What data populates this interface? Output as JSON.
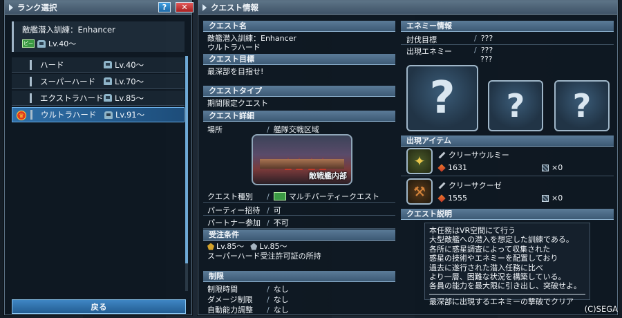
{
  "rank_panel": {
    "title": "ランク選択",
    "help_label": "?",
    "close_label": "✕",
    "quest_name": "敵艦潜入訓練：Enhancer",
    "quest_badge": "ピー",
    "quest_level": "Lv.40～",
    "ranks": [
      {
        "label": "ハード",
        "level": "Lv.40～"
      },
      {
        "label": "スーパーハード",
        "level": "Lv.70～"
      },
      {
        "label": "エクストラハード",
        "level": "Lv.85～"
      },
      {
        "label": "ウルトラハード",
        "level": "Lv.91～"
      }
    ],
    "back_label": "戻る"
  },
  "info_panel": {
    "title": "クエスト情報",
    "quest_name_header": "クエスト名",
    "quest_name_line1": "敵艦潜入訓練：Enhancer",
    "quest_name_line2": "ウルトラハード",
    "objective_header": "クエスト目標",
    "objective": "最深部を目指せ!",
    "type_header": "クエストタイプ",
    "type": "期間限定クエスト",
    "detail_header": "クエスト詳細",
    "location_label": "場所",
    "location_value": "艦隊交戦区域",
    "location_caption": "敵戦艦内部",
    "category_label": "クエスト種別",
    "category_value": "マルチパーティークエスト",
    "party_label": "パーティー招待",
    "party_value": "可",
    "partner_label": "パートナー参加",
    "partner_value": "不可",
    "conditions_header": "受注条件",
    "cond_lv1": "Lv.85～",
    "cond_lv2": "Lv.85～",
    "cond_text": "スーパーハード受注許可証の所持",
    "limits_header": "制限",
    "time_label": "制限時間",
    "time_value": "なし",
    "damage_label": "ダメージ制限",
    "damage_value": "なし",
    "auto_label": "自動能力調整",
    "auto_value": "なし",
    "enemy_header": "エネミー情報",
    "target_label": "討伐目標",
    "target_value": "???",
    "appear_label": "出現エネミー",
    "appear_value1": "???",
    "appear_value2": "???",
    "unknown_mark": "?",
    "items_header": "出現アイテム",
    "items": [
      {
        "name": "クリーサウルミー",
        "number": "1631",
        "count": "×0"
      },
      {
        "name": "クリーサクーゼ",
        "number": "1555",
        "count": "×0"
      }
    ],
    "desc_header": "クエスト説明",
    "desc_lines": [
      "本任務はVR空間にて行う",
      "大型敵艦への潜入を想定した訓練である。",
      "各所に惑星調査によって収集された",
      "惑星の技術やエネミーを配置しており",
      "過去に遂行された潜入任務に比べ",
      "より一層、困難な状況を構築している。",
      "各員の能力を最大限に引き出し、突破せよ。"
    ],
    "desc_goal": "最深部に出現するエネミーの撃破でクリア"
  },
  "copyright": "(C)SEGA"
}
